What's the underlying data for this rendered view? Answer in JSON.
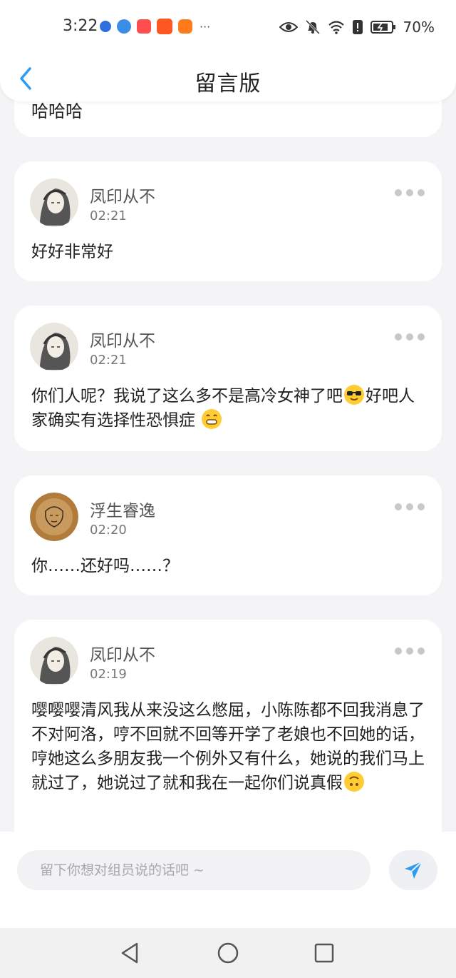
{
  "status_bar": {
    "time": "3:22",
    "battery": "70%",
    "more": "···",
    "notification_icons": [
      "baidu-icon",
      "browser-icon",
      "red-app-icon",
      "taobao-icon",
      "video-app-icon"
    ],
    "system_icons": [
      "eye-icon",
      "bell-off-icon",
      "wifi-icon",
      "alert-icon",
      "battery-icon"
    ]
  },
  "header": {
    "title": "留言版"
  },
  "partial_message": {
    "body": "哈哈哈"
  },
  "messages": [
    {
      "user": "凤印从不",
      "time": "02:21",
      "body": "好好非常好"
    },
    {
      "user": "凤印从不",
      "time": "02:21",
      "body_parts": [
        "你们人呢？我说了这么多不是高冷女神了吧",
        "好吧人家确实有选择性恐惧症 "
      ]
    },
    {
      "user": "浮生睿逸",
      "time": "02:20",
      "body": "你……还好吗……？"
    },
    {
      "user": "凤印从不",
      "time": "02:19",
      "body": "嘤嘤嘤清风我从来没这么憋屈，小陈陈都不回我消息了不对阿洛，哼不回就不回等开学了老娘也不回她的话，哼她这么多朋友我一个例外又有什么，她说的我们马上就过了，她说过了就和我在一起你们说真假"
    }
  ],
  "composer": {
    "placeholder": "留下你想对组员说的话吧 ~",
    "value": ""
  },
  "colors": {
    "accent": "#2e9bf0",
    "background": "#f4f4f6",
    "card": "#ffffff"
  }
}
